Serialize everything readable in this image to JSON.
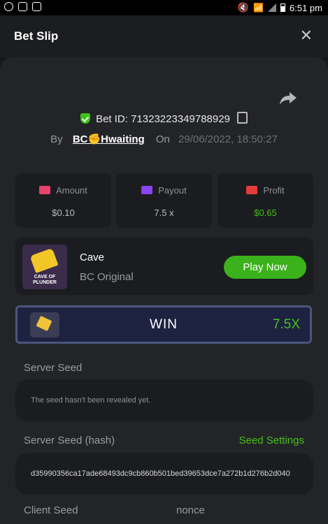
{
  "status_bar": {
    "time": "6:51 pm",
    "icons": [
      "messenger-icon",
      "gmail-icon",
      "gallery-icon",
      "mute-icon",
      "wifi-icon",
      "signal-icon",
      "battery-icon"
    ]
  },
  "header": {
    "title": "Bet Slip",
    "close_icon": "close-icon"
  },
  "bet": {
    "bet_id_label": "Bet ID: 71323223349788929",
    "by_label": "By",
    "user": "BC✊Hwaiting",
    "on_label": "On",
    "date": "29/06/2022, 18:50:27"
  },
  "stats": [
    {
      "label": "Amount",
      "value": "$0.10",
      "icon": "amount-icon",
      "icon_color": "#e8436c"
    },
    {
      "label": "Payout",
      "value": "7.5 x",
      "icon": "payout-icon",
      "icon_color": "#8b44f0"
    },
    {
      "label": "Profit",
      "value": "$0.65",
      "icon": "profit-icon",
      "icon_color": "#e63c3c"
    }
  ],
  "game": {
    "name": "Cave",
    "provider": "BC Original",
    "thumb_text": "CAVE OF PLUNDER",
    "play_label": "Play Now"
  },
  "result": {
    "label": "WIN",
    "multiplier": "7.5X"
  },
  "seeds": {
    "server_seed_label": "Server Seed",
    "server_seed_value": "The seed hasn't been revealed yet.",
    "server_hash_label": "Server Seed (hash)",
    "seed_settings_label": "Seed Settings",
    "server_hash_value": "d35990356ca17ade68493dc9cb860b501bed39653dce7a272b1d276b2d040",
    "client_seed_label": "Client Seed",
    "nonce_label": "nonce"
  },
  "colors": {
    "accent_green": "#43c41a",
    "background": "#17181b",
    "panel": "#232427",
    "card": "#1b1c1f"
  }
}
